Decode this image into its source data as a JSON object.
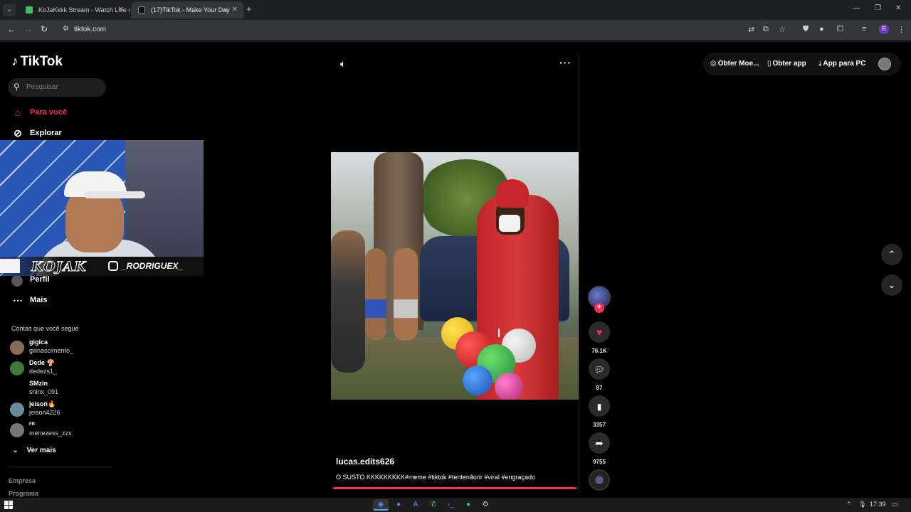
{
  "browser": {
    "tabs": [
      {
        "title": "KoJaKkkk Stream - Watch Live o",
        "active": false
      },
      {
        "title": "(17)TikTok - Make Your Day",
        "active": true
      }
    ],
    "url": "tiktok.com",
    "profile_initial": "R"
  },
  "tiktok": {
    "logo_text": "TikTok",
    "search_placeholder": "Pesquisar",
    "nav": [
      {
        "label": "Para você",
        "icon": "home-icon",
        "active": true
      },
      {
        "label": "Explorar",
        "icon": "compass-icon",
        "active": false
      },
      {
        "label": "Perfil",
        "icon": "profile-icon",
        "active": false
      },
      {
        "label": "Mais",
        "icon": "more-icon",
        "active": false
      }
    ],
    "following_title": "Contas que você segue",
    "following": [
      {
        "name": "gigica",
        "handle": "giiinascimento_",
        "color": "#8a6b5a"
      },
      {
        "name": "Dede 🍄",
        "handle": "dedezs1_",
        "color": "#3f7a3a"
      },
      {
        "name": "SMzin",
        "handle": "shinx_091",
        "color": "#000000"
      },
      {
        "name": "jeison🔥",
        "handle": "jeison4226",
        "color": "#6a8aa0"
      },
      {
        "name": "FR",
        "handle": "menezess_zzx",
        "color": "#777777"
      }
    ],
    "see_more": "Ver mais",
    "footer": [
      "Empresa",
      "Programa"
    ]
  },
  "webcam": {
    "tag": "KOJAK",
    "handle": "_RODRIGUEX_"
  },
  "video": {
    "author": "lucas.edits626",
    "caption": "O SUSTO KKKKKKKKK#meme #tiktok #tentenãorir #viral #engraçado",
    "progress": 0.99,
    "likes": "76.1K",
    "comments": "87",
    "saves": "3357",
    "shares": "9755"
  },
  "top_actions": {
    "coins": "Obter Moe...",
    "get_app": "Obter app",
    "pc_app": "App para PC"
  },
  "taskbar": {
    "time": "17:39"
  },
  "colors": {
    "accent": "#fe2c55",
    "background": "#000000"
  }
}
